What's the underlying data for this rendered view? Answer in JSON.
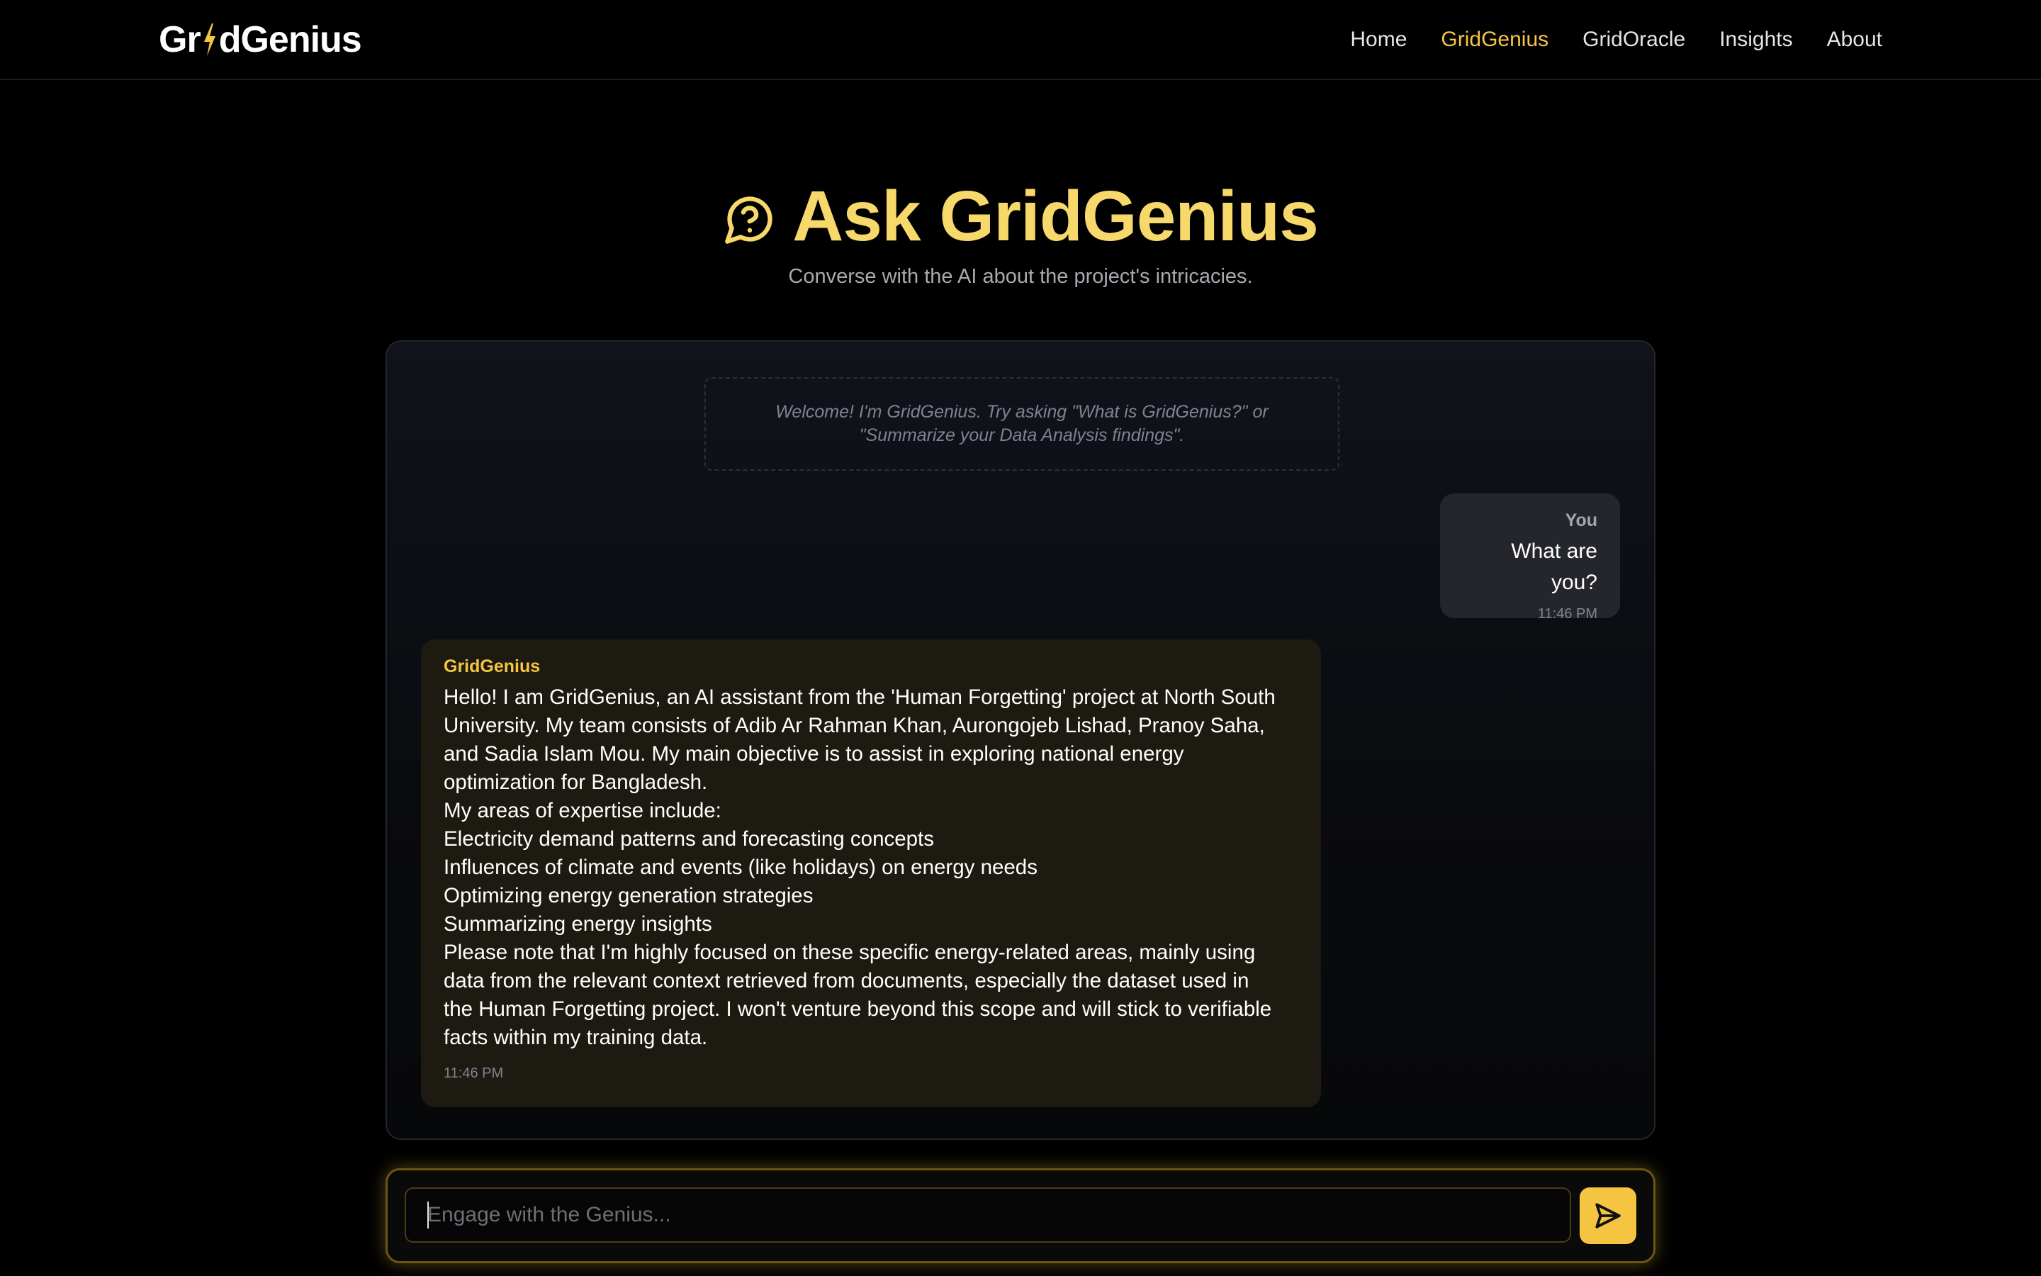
{
  "brand": {
    "logo_prefix": "Gr",
    "logo_suffix": "dGenius",
    "accent_color": "#f5c542"
  },
  "nav": {
    "items": [
      {
        "label": "Home",
        "active": false
      },
      {
        "label": "GridGenius",
        "active": true
      },
      {
        "label": "GridOracle",
        "active": false
      },
      {
        "label": "Insights",
        "active": false
      },
      {
        "label": "About",
        "active": false
      }
    ]
  },
  "hero": {
    "icon": "chat-question-icon",
    "title": "Ask GridGenius",
    "subtitle": "Converse with the AI about the project's intricacies."
  },
  "chat": {
    "welcome_line1": "Welcome! I'm GridGenius. Try asking \"What is GridGenius?\" or",
    "welcome_line2": "\"Summarize your Data Analysis findings\".",
    "user_message": {
      "sender": "You",
      "text": "What are you?",
      "time": "11:46 PM"
    },
    "ai_message": {
      "sender": "GridGenius",
      "lines": [
        "Hello! I am GridGenius, an AI assistant from the 'Human Forgetting' project at North South",
        "University. My team consists of Adib Ar Rahman Khan, Aurongojeb Lishad, Pranoy Saha,",
        "and Sadia Islam Mou. My main objective is to assist in exploring national energy",
        "optimization for Bangladesh.",
        "My areas of expertise include:",
        "Electricity demand patterns and forecasting concepts",
        "Influences of climate and events (like holidays) on energy needs",
        "Optimizing energy generation strategies",
        "Summarizing energy insights",
        "Please note that I'm highly focused on these specific energy-related areas, mainly using",
        "data from the relevant context retrieved from documents, especially the dataset used in",
        "the Human Forgetting project. I won't venture beyond this scope and will stick to verifiable",
        "facts within my training data."
      ],
      "time": "11:46 PM"
    }
  },
  "composer": {
    "placeholder": "Engage with the Genius...",
    "value": "",
    "send_icon": "send-icon"
  }
}
